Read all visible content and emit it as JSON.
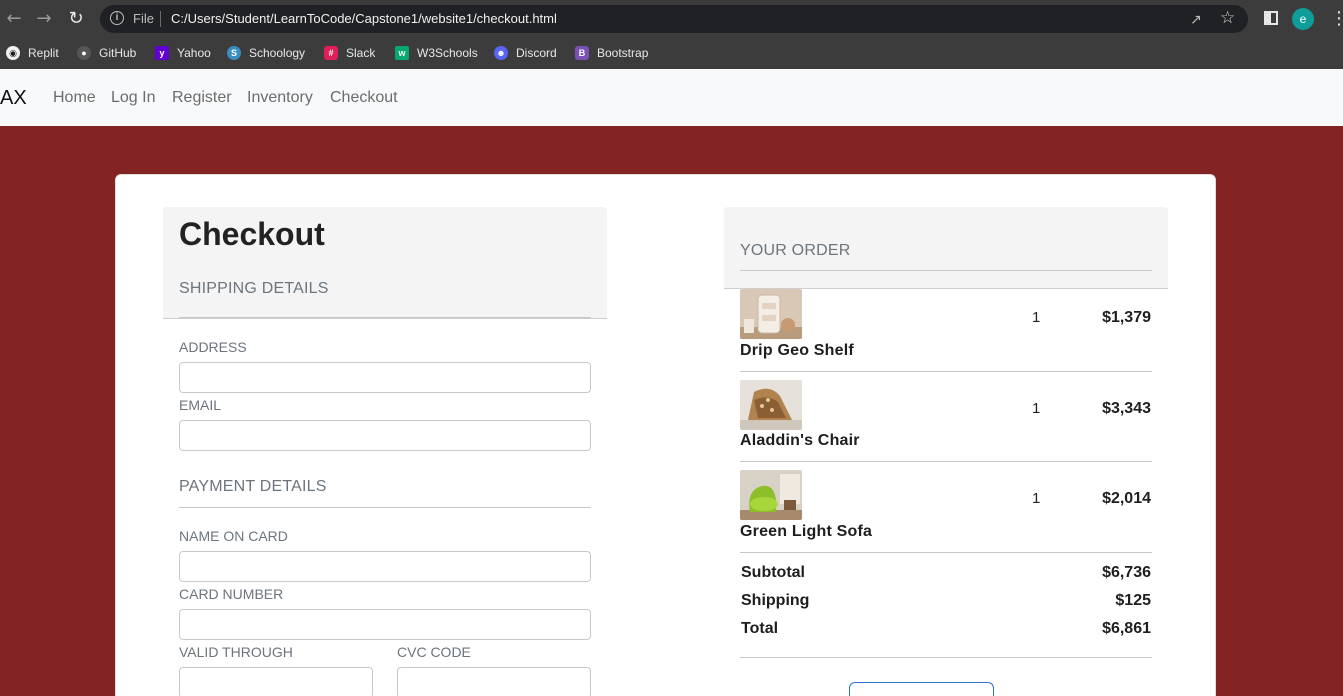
{
  "browser": {
    "url_scheme": "File",
    "url": "C:/Users/Student/LearnToCode/Capstone1/website1/checkout.html",
    "profile_initial": "e",
    "bookmarks": [
      {
        "label": "Replit",
        "icon": "replit-icon",
        "color": "#1a1a1a"
      },
      {
        "label": "GitHub",
        "icon": "github-icon",
        "color": "#555555"
      },
      {
        "label": "Yahoo",
        "icon": "yahoo-icon",
        "color": "#6001d2"
      },
      {
        "label": "Schoology",
        "icon": "schoology-icon",
        "color": "#3b8ec2"
      },
      {
        "label": "Slack",
        "icon": "slack-icon",
        "color": "#e01e5a"
      },
      {
        "label": "W3Schools",
        "icon": "w3schools-icon",
        "color": "#04aa6d"
      },
      {
        "label": "Discord",
        "icon": "discord-icon",
        "color": "#5865f2"
      },
      {
        "label": "Bootstrap",
        "icon": "bootstrap-icon",
        "color": "#7952b3"
      }
    ]
  },
  "site": {
    "brand": "AX",
    "nav": [
      "Home",
      "Log In",
      "Register",
      "Inventory",
      "Checkout"
    ],
    "background": "#832324"
  },
  "checkout": {
    "title": "Checkout",
    "shipping_title": "SHIPPING DETAILS",
    "address_label": "ADDRESS",
    "email_label": "EMAIL",
    "payment_title": "PAYMENT DETAILS",
    "name_label": "NAME ON CARD",
    "card_label": "CARD NUMBER",
    "valid_label": "VALID THROUGH",
    "cvc_label": "CVC CODE"
  },
  "order": {
    "title": "YOUR ORDER",
    "items": [
      {
        "name": "Drip Geo Shelf",
        "qty": "1",
        "price": "$1,379"
      },
      {
        "name": "Aladdin's Chair",
        "qty": "1",
        "price": "$3,343"
      },
      {
        "name": "Green Light Sofa",
        "qty": "1",
        "price": "$2,014"
      }
    ],
    "subtotal_label": "Subtotal",
    "subtotal": "$6,736",
    "shipping_label": "Shipping",
    "shipping": "$125",
    "total_label": "Total",
    "total": "$6,861"
  }
}
